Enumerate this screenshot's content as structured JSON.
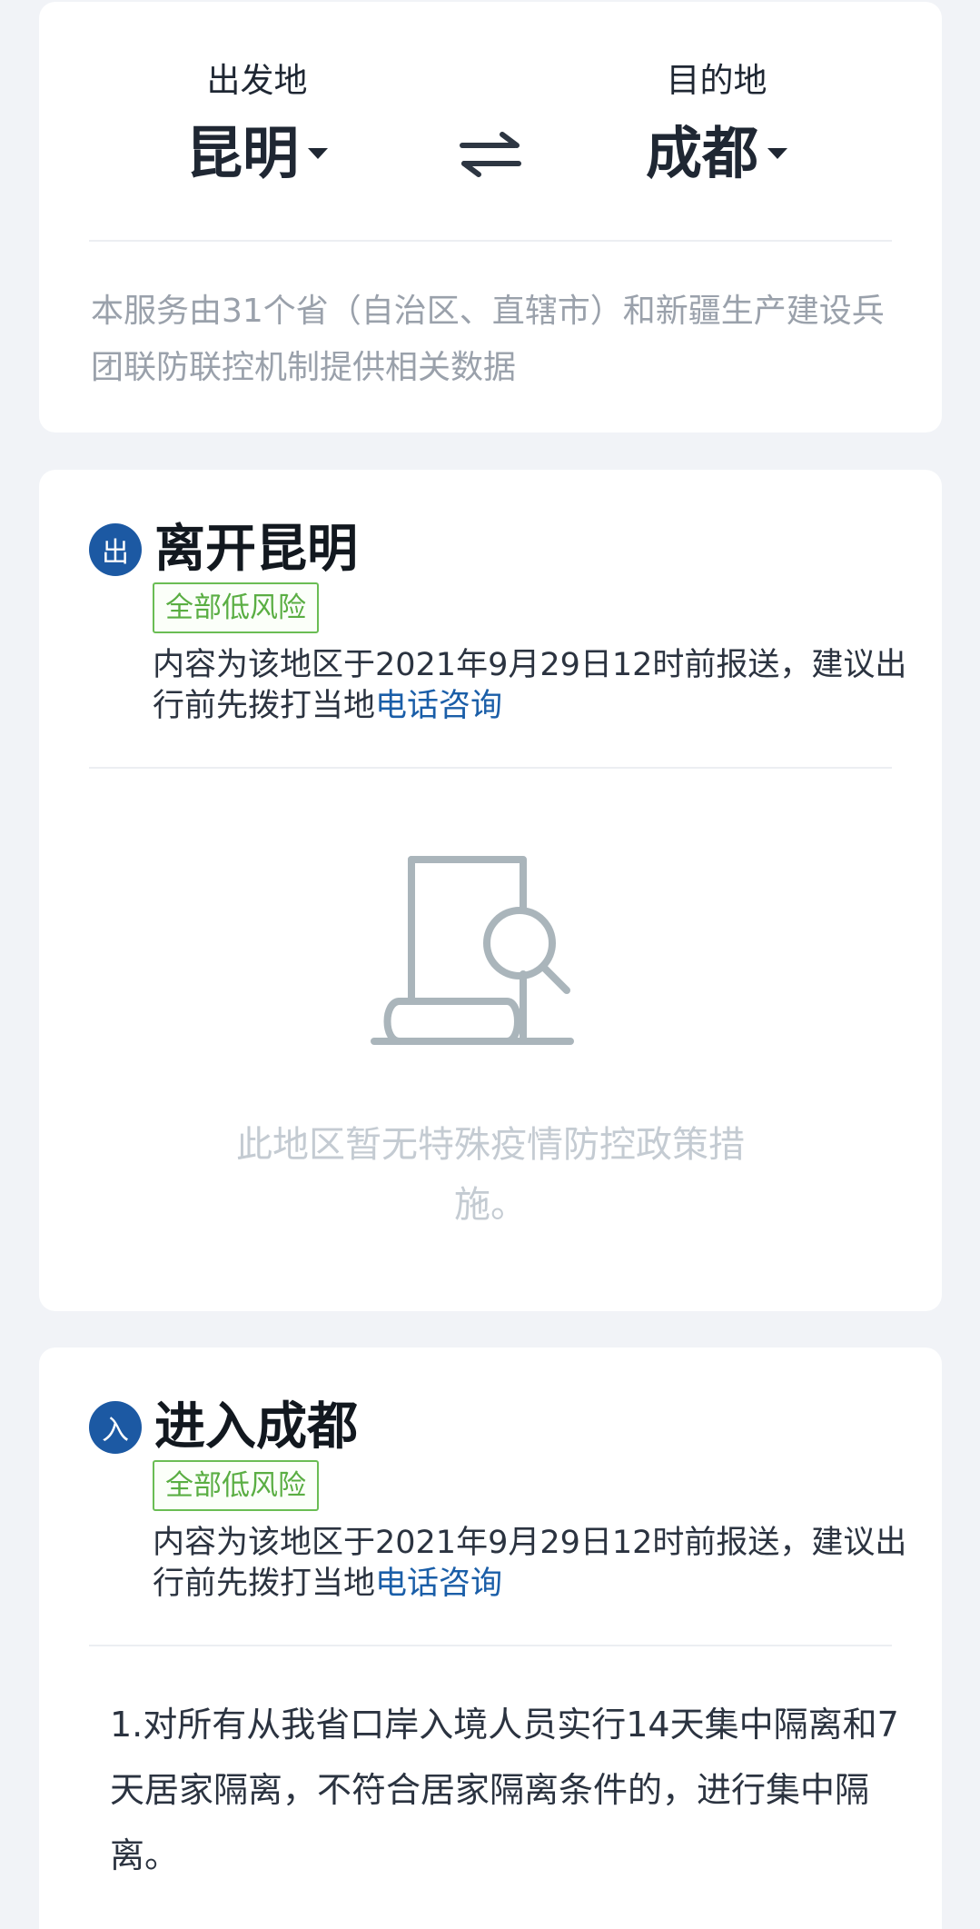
{
  "route": {
    "from_label": "出发地",
    "from_city": "昆明",
    "to_label": "目的地",
    "to_city": "成都",
    "note": "本服务由31个省（自治区、直辖市）和新疆生产建设兵团联防联控机制提供相关数据"
  },
  "leave": {
    "icon_text": "出",
    "title": "离开昆明",
    "risk_badge": "全部低风险",
    "report_text": "内容为该地区于2021年9月29日12时前报送，建议出行前先拨打当地",
    "consult_link": "电话咨询",
    "empty_text": "此地区暂无特殊疫情防控政策措施。"
  },
  "enter": {
    "icon_text": "入",
    "title": "进入成都",
    "risk_badge": "全部低风险",
    "report_text": "内容为该地区于2021年9月29日12时前报送，建议出行前先拨打当地",
    "consult_link": "电话咨询",
    "policy_text": "1.对所有从我省口岸入境人员实行14天集中隔离和7天居家隔离，不符合居家隔离条件的，进行集中隔离。"
  },
  "colors": {
    "page_bg": "#f1f3f7",
    "accent_blue": "#1c59a3",
    "link_blue": "#1a5ea8",
    "risk_green": "#5aae43",
    "muted_gray": "#9aa1ab"
  },
  "icons": {
    "swap": "swap-arrows-icon",
    "dropdown": "caret-down-icon",
    "empty": "document-search-icon"
  }
}
